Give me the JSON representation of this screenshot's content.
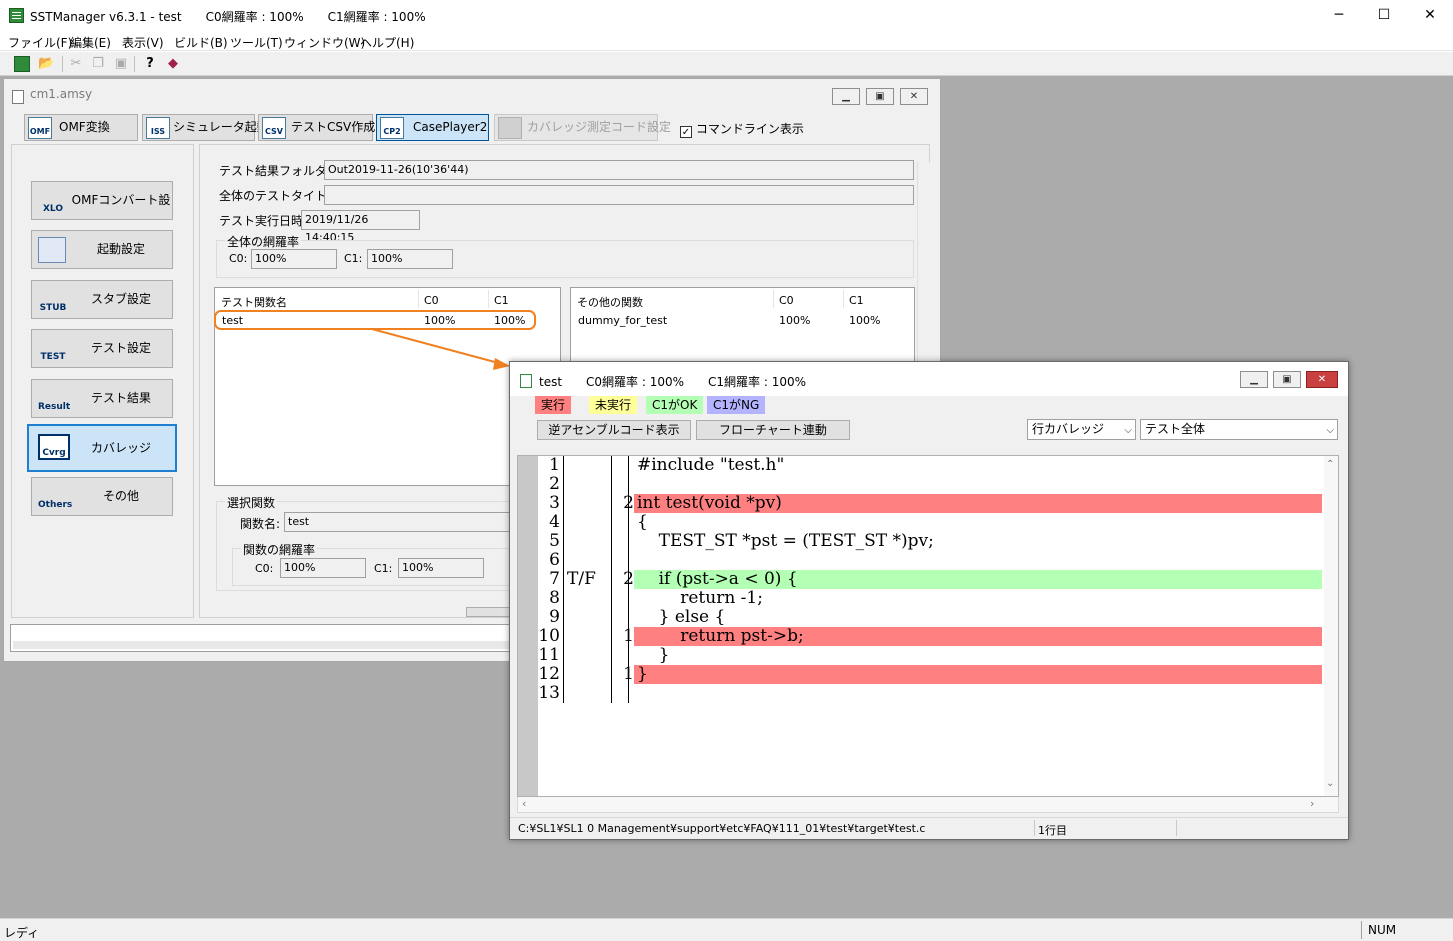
{
  "app": {
    "title": "SSTManager v6.3.1 - test　　C0網羅率 : 100%　　C1網羅率 : 100%",
    "caption_buttons": {
      "minimize": "─",
      "maximize": "☐",
      "close": "✕"
    }
  },
  "menu": [
    "ファイル(F)",
    "編集(E)",
    "表示(V)",
    "ビルド(B)",
    "ツール(T)",
    "ウィンドウ(W)",
    "ヘルプ(H)"
  ],
  "toolbar": {
    "icons": [
      "new-project-icon",
      "open-folder-icon",
      "cut-icon",
      "copy-icon",
      "paste-icon",
      "help-icon",
      "book-icon"
    ]
  },
  "cm1": {
    "title": "cm1.amsy",
    "buttons": {
      "omf": "OMF変換",
      "simulator": "シミュレータ起動",
      "csv": "テストCSV作成",
      "caseplayer": "CasePlayer2",
      "coverage_code": "カバレッジ測定コード設定"
    },
    "button_icons": {
      "omf": "OMF",
      "simulator": "ISS",
      "csv": "CSV",
      "caseplayer": "CP2"
    },
    "cmdline_label": "コマンドライン表示",
    "sidebar": [
      {
        "label": "OMFコンバート設定",
        "icon": "XLO"
      },
      {
        "label": "起動設定",
        "icon": ""
      },
      {
        "label": "スタブ設定",
        "icon": "STUB"
      },
      {
        "label": "テスト設定",
        "icon": "TEST"
      },
      {
        "label": "テスト結果",
        "icon": "Result"
      },
      {
        "label": "カバレッジ",
        "icon": "Cvrg"
      },
      {
        "label": "その他",
        "icon": "Others"
      }
    ],
    "result_folder_label": "テスト結果フォルダ名:",
    "result_folder_value": "Out2019-11-26(10'36'44)",
    "test_title_label": "全体のテストタイトル:",
    "test_title_value": "",
    "test_date_label": "テスト実行日時:",
    "test_date_value": "2019/11/26 14:40:15",
    "overall_group": "全体の網羅率",
    "c0_label": "C0:",
    "c0_value": "100%",
    "c1_label": "C1:",
    "c1_value": "100%",
    "test_functions": {
      "headers": [
        "テスト関数名",
        "C0",
        "C1"
      ],
      "rows": [
        {
          "name": "test",
          "c0": "100%",
          "c1": "100%"
        }
      ]
    },
    "other_functions": {
      "headers": [
        "その他の関数",
        "C0",
        "C1"
      ],
      "rows": [
        {
          "name": "dummy_for_test",
          "c0": "100%",
          "c1": "100%"
        }
      ]
    },
    "selected_group": "選択関数",
    "func_name_label": "関数名:",
    "func_name_value": "test",
    "func_cov_group": "関数の網羅率",
    "func_c0_label": "C0:",
    "func_c0_value": "100%",
    "func_c1_label": "C1:",
    "func_c1_value": "100%"
  },
  "testwin": {
    "title": "test　　C0網羅率 : 100%　　C1網羅率 : 100%",
    "legend": {
      "executed": "実行",
      "not_executed": "未実行",
      "c1_ok": "C1がOK",
      "c1_ng": "C1がNG"
    },
    "buttons": {
      "disasm": "逆アセンブルコード表示",
      "flowchart": "フローチャート連動"
    },
    "combo_coverage": "行カバレッジ",
    "combo_scope": "テスト全体",
    "code_lines": [
      {
        "ln": "1",
        "tf": "",
        "count": "",
        "src": "#include \"test.h\"",
        "hl": ""
      },
      {
        "ln": "2",
        "tf": "",
        "count": "",
        "src": "",
        "hl": ""
      },
      {
        "ln": "3",
        "tf": "",
        "count": "2",
        "src": "int test(void *pv)",
        "hl": "red"
      },
      {
        "ln": "4",
        "tf": "",
        "count": "",
        "src": "{",
        "hl": ""
      },
      {
        "ln": "5",
        "tf": "",
        "count": "",
        "src": "    TEST_ST *pst = (TEST_ST *)pv;",
        "hl": ""
      },
      {
        "ln": "6",
        "tf": "",
        "count": "",
        "src": "",
        "hl": ""
      },
      {
        "ln": "7",
        "tf": "T/F",
        "count": "2",
        "src": "    if (pst->a < 0) {",
        "hl": "green"
      },
      {
        "ln": "8",
        "tf": "",
        "count": "",
        "src": "        return -1;",
        "hl": ""
      },
      {
        "ln": "9",
        "tf": "",
        "count": "",
        "src": "    } else {",
        "hl": ""
      },
      {
        "ln": "10",
        "tf": "",
        "count": "1",
        "src": "        return pst->b;",
        "hl": "red"
      },
      {
        "ln": "11",
        "tf": "",
        "count": "",
        "src": "    }",
        "hl": ""
      },
      {
        "ln": "12",
        "tf": "",
        "count": "1",
        "src": "}",
        "hl": "red"
      },
      {
        "ln": "13",
        "tf": "",
        "count": "",
        "src": "",
        "hl": ""
      }
    ],
    "status_path": "C:¥SL1¥SL1 0 Management¥support¥etc¥FAQ¥111_01¥test¥target¥test.c",
    "status_line": "1行目"
  },
  "status": {
    "text": "レディ",
    "num": "NUM"
  },
  "colors": {
    "executed": "#ff8080",
    "not_executed": "#ffff99",
    "c1_ok": "#b3ffb3",
    "c1_ng": "#b3b3ff",
    "annotation": "#f08020",
    "mdi_background": "#ababab"
  }
}
